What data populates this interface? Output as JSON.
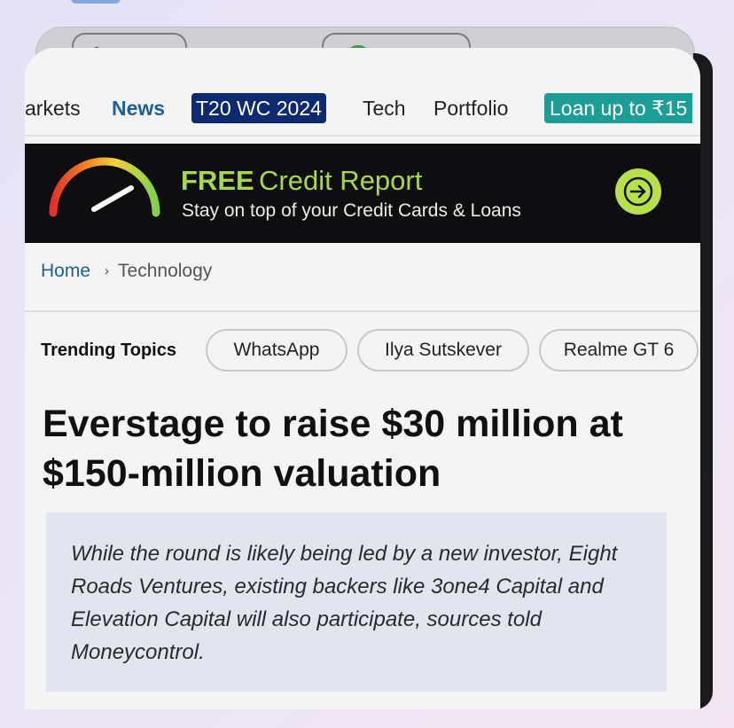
{
  "nav": {
    "items": [
      {
        "label": "arkets"
      },
      {
        "label": "News"
      },
      {
        "label": "T20 WC 2024"
      },
      {
        "label": "Tech"
      },
      {
        "label": "Portfolio"
      },
      {
        "label": "Loan up to ₹15"
      }
    ]
  },
  "banner": {
    "free": "FREE",
    "title": "Credit Report",
    "subtitle": "Stay on top of your Credit Cards & Loans",
    "icon": "arrow-right-icon",
    "accent": "#a8d84a"
  },
  "breadcrumb": {
    "home": "Home",
    "separator": "›",
    "current": "Technology"
  },
  "trending": {
    "label": "Trending Topics",
    "topics": [
      "WhatsApp",
      "Ilya Sutskever",
      "Realme GT 6"
    ]
  },
  "article": {
    "headline": "Everstage to raise $30 million at $150-million valuation",
    "summary": "While the round is likely being led by a new investor, Eight Roads Ventures, existing backers like 3one4 Capital and Elevation Capital will also participate, sources told Moneycontrol."
  },
  "colors": {
    "link": "#1d5f96",
    "t20_badge": "#0d2a70",
    "loan_badge": "#1b9e96"
  }
}
